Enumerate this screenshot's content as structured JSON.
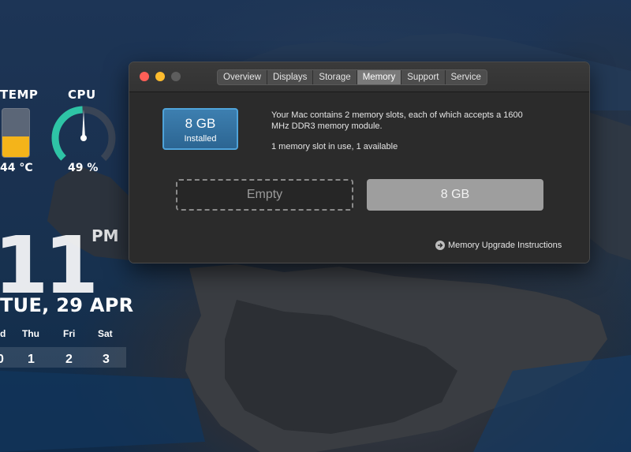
{
  "desktop": {
    "temp": {
      "label": "TEMP",
      "value": "44 °C",
      "fill_fraction": 0.42,
      "fill_color": "#f4b41a"
    },
    "cpu": {
      "label": "CPU",
      "value": "49 %",
      "percent": 49,
      "gauge_color": "#2ec4a6"
    },
    "clock": {
      "time": "11",
      "meridiem": "PM",
      "date": "TUE, 29 APR"
    },
    "week": {
      "days": [
        {
          "name": "d",
          "num": "0"
        },
        {
          "name": "Thu",
          "num": "1"
        },
        {
          "name": "Fri",
          "num": "2"
        },
        {
          "name": "Sat",
          "num": "3"
        }
      ]
    }
  },
  "window": {
    "tabs": [
      {
        "label": "Overview"
      },
      {
        "label": "Displays"
      },
      {
        "label": "Storage"
      },
      {
        "label": "Memory",
        "active": true
      },
      {
        "label": "Support"
      },
      {
        "label": "Service"
      }
    ],
    "installed": {
      "size": "8 GB",
      "label": "Installed",
      "accent": "#4fa3d9"
    },
    "info_line1": "Your Mac contains 2 memory slots, each of which accepts a 1600 MHz DDR3 memory module.",
    "info_line2": "1 memory slot in use, 1 available",
    "slots": {
      "empty_label": "Empty",
      "filled_label": "8 GB"
    },
    "upgrade_link": "Memory Upgrade Instructions"
  }
}
